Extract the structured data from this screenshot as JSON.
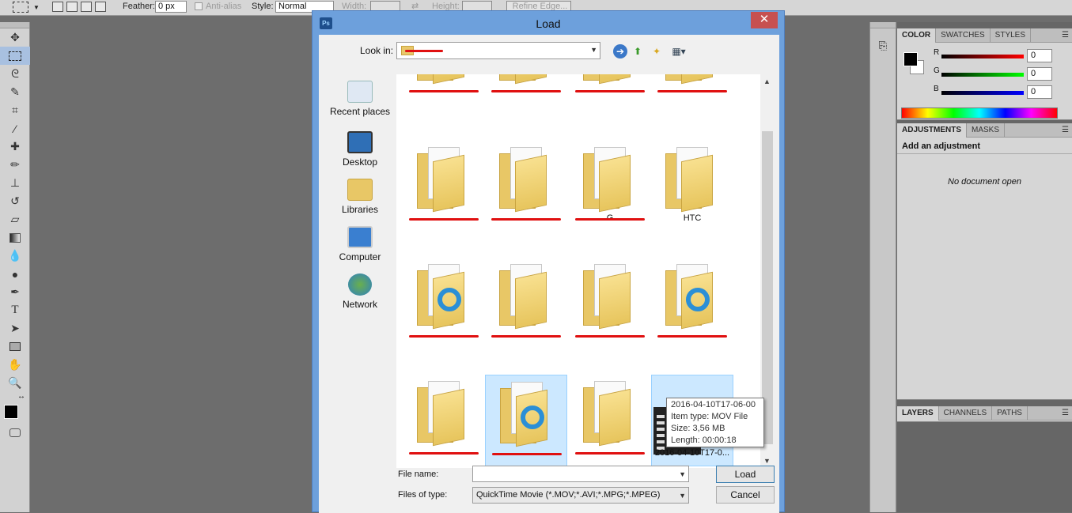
{
  "options_bar": {
    "feather_label": "Feather:",
    "feather_value": "0 px",
    "anti_alias_label": "Anti-alias",
    "style_label": "Style:",
    "style_value": "Normal",
    "width_label": "Width:",
    "height_label": "Height:",
    "refine_edge_label": "Refine Edge..."
  },
  "panels": {
    "color_tabs": [
      "COLOR",
      "SWATCHES",
      "STYLES"
    ],
    "rgb": [
      {
        "label": "R",
        "value": "0"
      },
      {
        "label": "G",
        "value": "0"
      },
      {
        "label": "B",
        "value": "0"
      }
    ],
    "adjust_tabs": [
      "ADJUSTMENTS",
      "MASKS"
    ],
    "add_adjustment": "Add an adjustment",
    "no_document": "No document open",
    "layers_tabs": [
      "LAYERS",
      "CHANNELS",
      "PATHS"
    ]
  },
  "dialog": {
    "title": "Load",
    "close": "✕",
    "look_in_label": "Look in:",
    "look_in_value": "",
    "places": [
      "Recent places",
      "Desktop",
      "Libraries",
      "Computer",
      "Network"
    ],
    "files": [
      {
        "name": "",
        "type": "folder",
        "redacted": true
      },
      {
        "name": "",
        "type": "folder",
        "redacted": true
      },
      {
        "name": "",
        "type": "folder",
        "redacted": true
      },
      {
        "name": "",
        "type": "folder",
        "redacted": true
      },
      {
        "name": "",
        "type": "folder",
        "redacted": true
      },
      {
        "name": "",
        "type": "folder",
        "redacted": true
      },
      {
        "name": "G",
        "type": "folder",
        "redacted": true
      },
      {
        "name": "HTC",
        "type": "folder",
        "redacted": false
      },
      {
        "name": "",
        "type": "folder-ie",
        "redacted": true
      },
      {
        "name": "",
        "type": "folder",
        "redacted": true
      },
      {
        "name": "",
        "type": "folder",
        "redacted": true
      },
      {
        "name": "",
        "type": "folder-ie",
        "redacted": true
      },
      {
        "name": "",
        "type": "folder",
        "redacted": true
      },
      {
        "name": "",
        "type": "folder-ie",
        "redacted": true
      },
      {
        "name": "",
        "type": "folder",
        "redacted": true
      },
      {
        "name": "2016-04-10T17-0...",
        "type": "movie",
        "redacted": false
      }
    ],
    "tooltip": [
      "2016-04-10T17-06-00",
      "Item type: MOV File",
      "Size: 3,56 MB",
      "Length: 00:00:18"
    ],
    "file_name_label": "File name:",
    "file_name_value": "",
    "files_of_type_label": "Files of type:",
    "files_of_type_value": "QuickTime Movie (*.MOV;*.AVI;*.MPG;*.MPEG)",
    "load_button": "Load",
    "cancel_button": "Cancel"
  }
}
